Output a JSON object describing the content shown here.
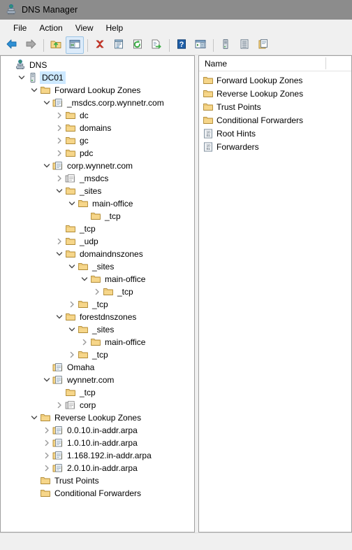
{
  "window": {
    "title": "DNS Manager",
    "app_icon": "dns-server-icon"
  },
  "menu": {
    "items": [
      {
        "label": "File"
      },
      {
        "label": "Action"
      },
      {
        "label": "View"
      },
      {
        "label": "Help"
      }
    ]
  },
  "toolbar": {
    "buttons": [
      {
        "name": "back-button",
        "icon": "arrow-left-icon",
        "pressed": false
      },
      {
        "name": "forward-button",
        "icon": "arrow-right-icon",
        "pressed": false
      },
      {
        "name": "up-one-level-button",
        "icon": "folder-up-icon",
        "pressed": false
      },
      {
        "name": "show-hide-tree-button",
        "icon": "console-tree-icon",
        "pressed": true
      },
      {
        "name": "delete-button",
        "icon": "delete-x-icon",
        "pressed": false
      },
      {
        "name": "properties-button",
        "icon": "properties-icon",
        "pressed": false
      },
      {
        "name": "refresh-button",
        "icon": "refresh-icon",
        "pressed": false
      },
      {
        "name": "export-list-button",
        "icon": "export-list-icon",
        "pressed": false
      },
      {
        "name": "help-button",
        "icon": "help-question-icon",
        "pressed": false
      },
      {
        "name": "show-actions-button",
        "icon": "actions-pane-icon",
        "pressed": false
      },
      {
        "name": "new-server-button",
        "icon": "server-icon",
        "pressed": false
      },
      {
        "name": "new-zone-button",
        "icon": "zone-list-icon",
        "pressed": false
      },
      {
        "name": "new-record-button",
        "icon": "new-record-icon",
        "pressed": false
      }
    ]
  },
  "tree": {
    "nodes": [
      {
        "label": "DNS",
        "depth": 0,
        "icon": "dns-root-icon",
        "twisty": "none",
        "selected": false
      },
      {
        "label": "DC01",
        "depth": 1,
        "icon": "server-icon",
        "twisty": "expanded",
        "selected": true
      },
      {
        "label": "Forward Lookup Zones",
        "depth": 2,
        "icon": "folder-icon",
        "twisty": "expanded",
        "selected": false
      },
      {
        "label": "_msdcs.corp.wynnetr.com",
        "depth": 3,
        "icon": "zone-icon",
        "twisty": "expanded",
        "selected": false
      },
      {
        "label": "dc",
        "depth": 4,
        "icon": "folder-icon",
        "twisty": "collapsed",
        "selected": false
      },
      {
        "label": "domains",
        "depth": 4,
        "icon": "folder-icon",
        "twisty": "collapsed",
        "selected": false
      },
      {
        "label": "gc",
        "depth": 4,
        "icon": "folder-icon",
        "twisty": "collapsed",
        "selected": false
      },
      {
        "label": "pdc",
        "depth": 4,
        "icon": "folder-icon",
        "twisty": "collapsed",
        "selected": false
      },
      {
        "label": "corp.wynnetr.com",
        "depth": 3,
        "icon": "zone-icon",
        "twisty": "expanded",
        "selected": false
      },
      {
        "label": "_msdcs",
        "depth": 4,
        "icon": "zone-delegation-icon",
        "twisty": "collapsed",
        "selected": false
      },
      {
        "label": "_sites",
        "depth": 4,
        "icon": "folder-icon",
        "twisty": "expanded",
        "selected": false
      },
      {
        "label": "main-office",
        "depth": 5,
        "icon": "folder-icon",
        "twisty": "expanded",
        "selected": false
      },
      {
        "label": "_tcp",
        "depth": 6,
        "icon": "folder-icon",
        "twisty": "none",
        "selected": false
      },
      {
        "label": "_tcp",
        "depth": 4,
        "icon": "folder-icon",
        "twisty": "none",
        "selected": false
      },
      {
        "label": "_udp",
        "depth": 4,
        "icon": "folder-icon",
        "twisty": "collapsed",
        "selected": false
      },
      {
        "label": "domaindnszones",
        "depth": 4,
        "icon": "folder-icon",
        "twisty": "expanded",
        "selected": false
      },
      {
        "label": "_sites",
        "depth": 5,
        "icon": "folder-icon",
        "twisty": "expanded",
        "selected": false
      },
      {
        "label": "main-office",
        "depth": 6,
        "icon": "folder-icon",
        "twisty": "expanded",
        "selected": false
      },
      {
        "label": "_tcp",
        "depth": 7,
        "icon": "folder-icon",
        "twisty": "collapsed",
        "selected": false
      },
      {
        "label": "_tcp",
        "depth": 5,
        "icon": "folder-icon",
        "twisty": "collapsed",
        "selected": false
      },
      {
        "label": "forestdnszones",
        "depth": 4,
        "icon": "folder-icon",
        "twisty": "expanded",
        "selected": false
      },
      {
        "label": "_sites",
        "depth": 5,
        "icon": "folder-icon",
        "twisty": "expanded",
        "selected": false
      },
      {
        "label": "main-office",
        "depth": 6,
        "icon": "folder-icon",
        "twisty": "collapsed",
        "selected": false
      },
      {
        "label": "_tcp",
        "depth": 5,
        "icon": "folder-icon",
        "twisty": "collapsed",
        "selected": false
      },
      {
        "label": "Omaha",
        "depth": 3,
        "icon": "zone-icon",
        "twisty": "none",
        "selected": false
      },
      {
        "label": "wynnetr.com",
        "depth": 3,
        "icon": "zone-icon",
        "twisty": "expanded",
        "selected": false
      },
      {
        "label": "_tcp",
        "depth": 4,
        "icon": "folder-icon",
        "twisty": "none",
        "selected": false
      },
      {
        "label": "corp",
        "depth": 4,
        "icon": "zone-delegation-icon",
        "twisty": "collapsed",
        "selected": false
      },
      {
        "label": "Reverse Lookup Zones",
        "depth": 2,
        "icon": "folder-icon",
        "twisty": "expanded",
        "selected": false
      },
      {
        "label": "0.0.10.in-addr.arpa",
        "depth": 3,
        "icon": "zone-icon",
        "twisty": "collapsed",
        "selected": false
      },
      {
        "label": "1.0.10.in-addr.arpa",
        "depth": 3,
        "icon": "zone-icon",
        "twisty": "collapsed",
        "selected": false
      },
      {
        "label": "1.168.192.in-addr.arpa",
        "depth": 3,
        "icon": "zone-icon",
        "twisty": "collapsed",
        "selected": false
      },
      {
        "label": "2.0.10.in-addr.arpa",
        "depth": 3,
        "icon": "zone-icon",
        "twisty": "collapsed",
        "selected": false
      },
      {
        "label": "Trust Points",
        "depth": 2,
        "icon": "folder-icon",
        "twisty": "none",
        "selected": false
      },
      {
        "label": "Conditional Forwarders",
        "depth": 2,
        "icon": "folder-icon",
        "twisty": "none",
        "selected": false
      }
    ]
  },
  "list": {
    "columns": [
      {
        "label": "Name"
      }
    ],
    "rows": [
      {
        "label": "Forward Lookup Zones",
        "icon": "folder-icon"
      },
      {
        "label": "Reverse Lookup Zones",
        "icon": "folder-icon"
      },
      {
        "label": "Trust Points",
        "icon": "folder-icon"
      },
      {
        "label": "Conditional Forwarders",
        "icon": "folder-icon"
      },
      {
        "label": "Root Hints",
        "icon": "binary-record-icon"
      },
      {
        "label": "Forwarders",
        "icon": "binary-record-icon"
      }
    ]
  },
  "statusbar": {
    "text": ""
  },
  "colors": {
    "titlebar": "#8c8c8c",
    "chrome": "#f0f0f0",
    "pane_border": "#a0a0a0",
    "selection": "#cce8ff",
    "folder": "#f8d989"
  }
}
